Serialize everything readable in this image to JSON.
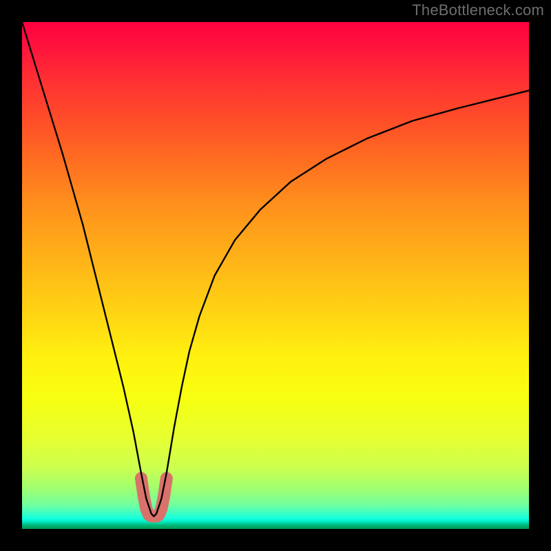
{
  "watermark": "TheBottleneck.com",
  "chart_data": {
    "type": "line",
    "title": "",
    "xlabel": "",
    "ylabel": "",
    "xlim": [
      0,
      100
    ],
    "ylim": [
      0,
      100
    ],
    "series": [
      {
        "name": "bottleneck-curve",
        "x": [
          0,
          4,
          8,
          12,
          14,
          16,
          18,
          20,
          22,
          23.5,
          24.5,
          25.5,
          26,
          26.5,
          27.5,
          28.5,
          30,
          31.5,
          33,
          35,
          38,
          42,
          47,
          53,
          60,
          68,
          77,
          86,
          94,
          100
        ],
        "values": [
          100,
          87,
          74,
          60,
          52,
          44,
          36,
          28,
          19,
          11,
          6,
          3,
          2.5,
          3,
          6,
          11,
          20,
          28,
          35,
          42,
          50,
          57,
          63,
          68.5,
          73,
          77,
          80.5,
          83,
          85,
          86.5
        ]
      },
      {
        "name": "salmon-underline",
        "x": [
          23.5,
          24.0,
          24.5,
          25.0,
          25.5,
          26.0,
          26.5,
          27.0,
          27.5,
          28.0,
          28.5
        ],
        "values": [
          10.0,
          6.5,
          4.0,
          2.8,
          2.5,
          2.5,
          2.5,
          2.8,
          4.0,
          6.5,
          10.0
        ]
      }
    ],
    "gradient_stops": [
      {
        "pos": 0,
        "color": "#ff0040"
      },
      {
        "pos": 12,
        "color": "#ff3232"
      },
      {
        "pos": 28,
        "color": "#ff7020"
      },
      {
        "pos": 46,
        "color": "#ffb018"
      },
      {
        "pos": 66,
        "color": "#fff010"
      },
      {
        "pos": 82,
        "color": "#e6ff30"
      },
      {
        "pos": 92,
        "color": "#a0ff70"
      },
      {
        "pos": 97,
        "color": "#38ffc8"
      },
      {
        "pos": 100,
        "color": "#009850"
      }
    ],
    "colors": {
      "curve": "#000000",
      "underline": "#d9726b",
      "watermark": "#6e6e6e",
      "background": "#000000"
    }
  }
}
